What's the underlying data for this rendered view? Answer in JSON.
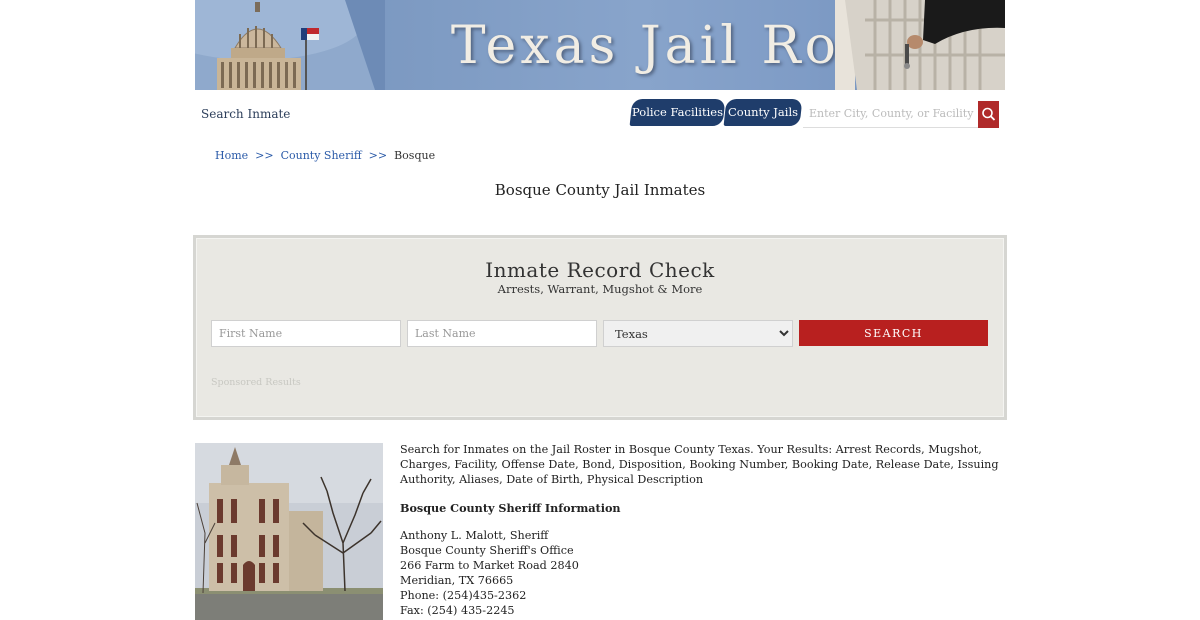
{
  "banner": {
    "title": "Texas Jail Roster"
  },
  "nav": {
    "search_inmate": "Search Inmate",
    "police_facilities": "Police Facilities",
    "county_jails": "County Jails",
    "search_placeholder": "Enter City, County, or Facility"
  },
  "breadcrumb": {
    "home": "Home",
    "sep": ">>",
    "county_sheriff": "County Sheriff",
    "current": "Bosque"
  },
  "page_title": "Bosque County Jail Inmates",
  "record_check": {
    "title": "Inmate Record Check",
    "subtitle": "Arrests, Warrant, Mugshot & More",
    "first_name_placeholder": "First Name",
    "last_name_placeholder": "Last Name",
    "state_selected": "Texas",
    "search_label": "SEARCH",
    "sponsored": "Sponsored Results"
  },
  "content": {
    "description": "Search for Inmates on the Jail Roster in Bosque County Texas. Your Results: Arrest Records, Mugshot, Charges, Facility, Offense Date, Bond, Disposition, Booking Number, Booking Date, Release Date, Issuing Authority, Aliases, Date of Birth, Physical Description",
    "info_heading": "Bosque County Sheriff Information",
    "info_lines": [
      "Anthony L. Malott, Sheriff",
      "Bosque County Sheriff's Office",
      "266 Farm to Market Road 2840",
      "Meridian, TX 76665",
      "Phone: (254)435-2362",
      "Fax: (254) 435-2245"
    ]
  },
  "colors": {
    "nav_blue": "#1f3d6b",
    "search_red": "#b8201f",
    "link_blue": "#2a5aa8"
  },
  "icons": {
    "site_search": "search-icon",
    "banner_left": "capitol-dome-image",
    "banner_right": "jail-cell-door-image"
  }
}
